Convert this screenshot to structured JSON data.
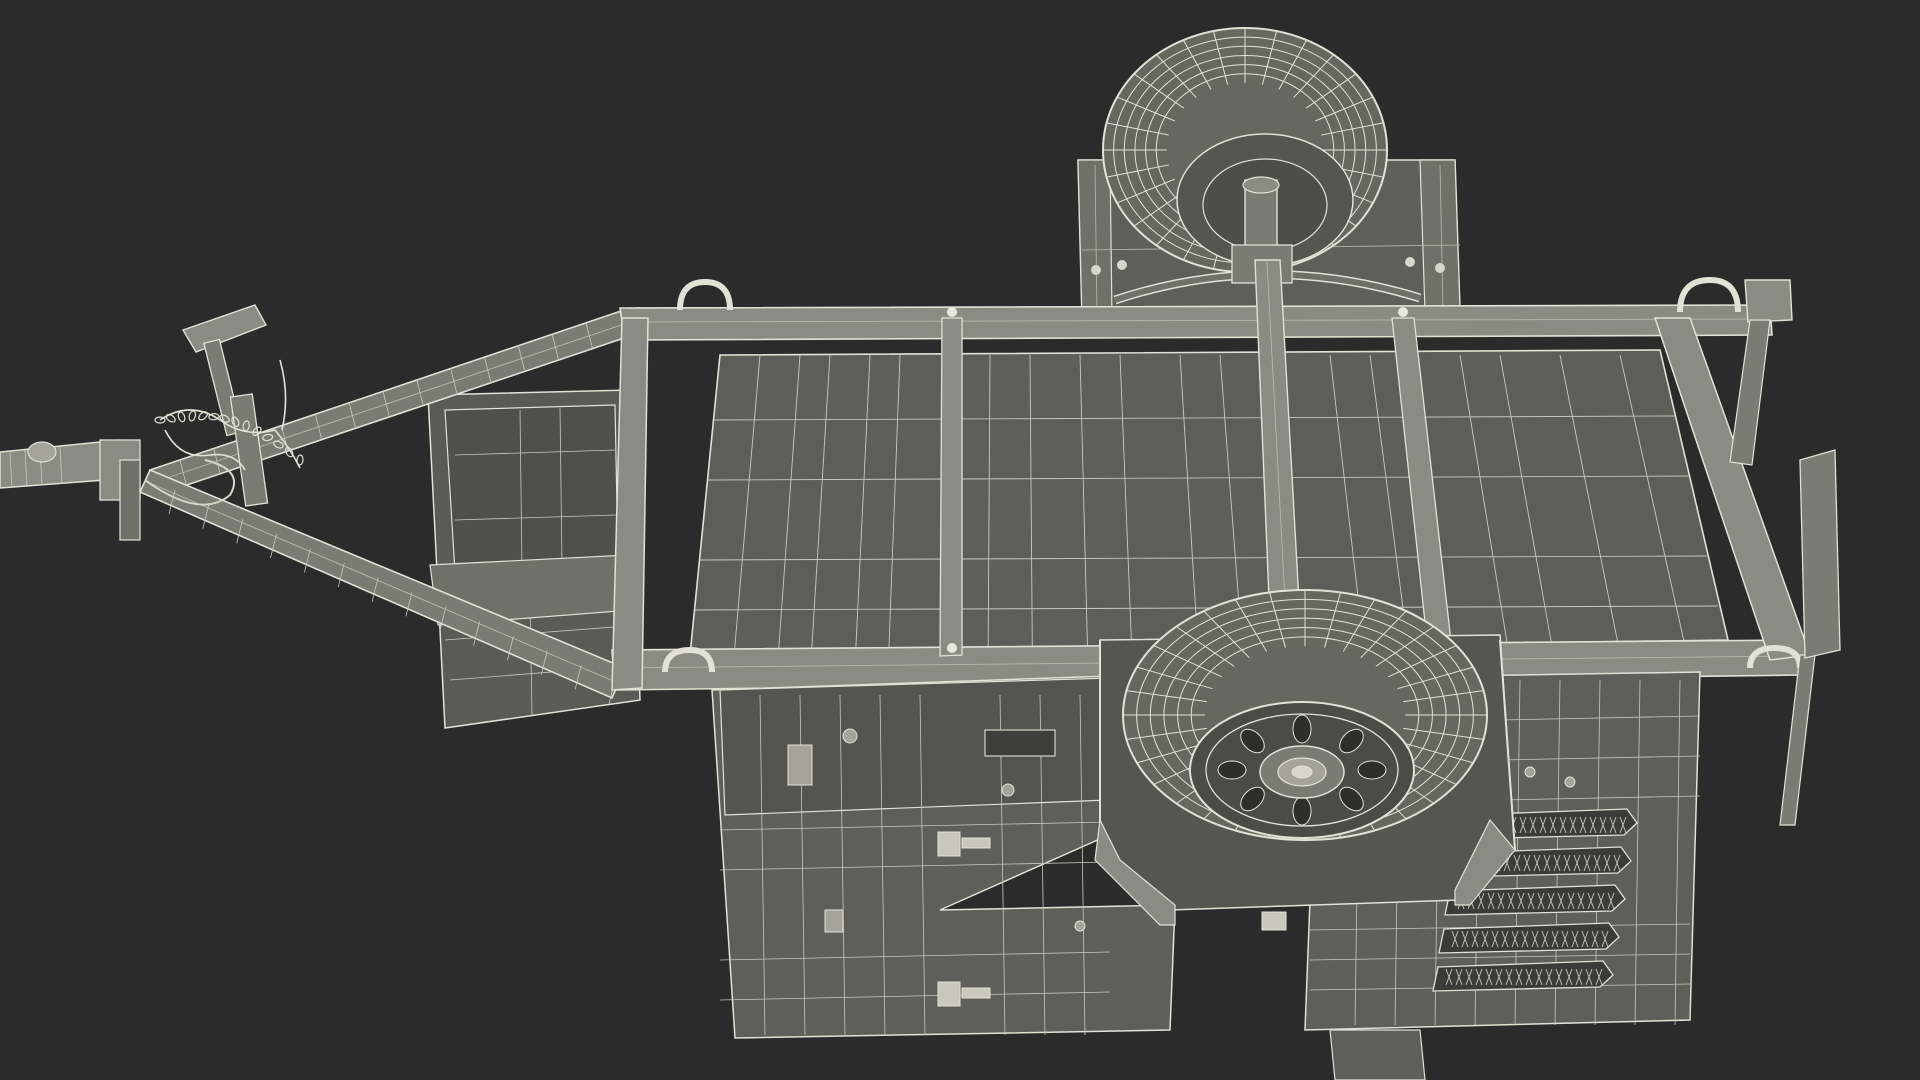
{
  "colors": {
    "background": "#2b2b2b",
    "surface_dark": "#5e5f58",
    "surface_mid": "#6f7068",
    "surface_light": "#8a8b82",
    "wire": "#e2e1d6",
    "wire_dim": "#b9b8ad",
    "shadow": "#1f1f1f"
  }
}
